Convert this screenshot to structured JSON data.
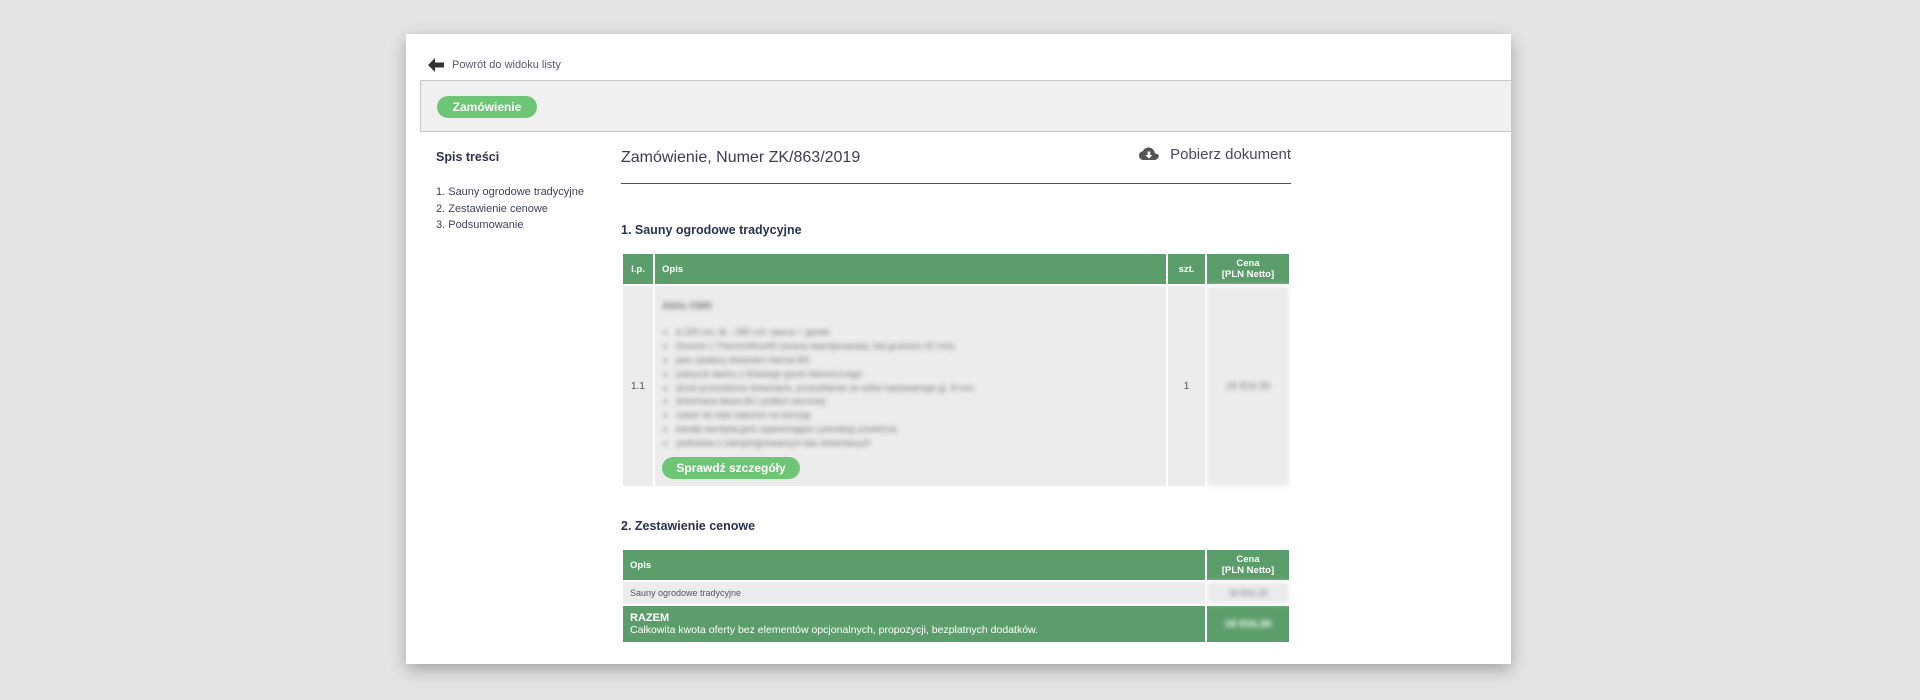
{
  "nav": {
    "back_label": "Powrót do widoku listy"
  },
  "header": {
    "order_button": "Zamówienie"
  },
  "toc": {
    "title": "Spis treści",
    "items": [
      "1. Sauny ogrodowe tradycyjne",
      "2. Zestawienie cenowe",
      "3. Podsumowanie"
    ]
  },
  "document": {
    "title": "Zamówienie, Numer ZK/863/2019",
    "download_label": "Pobierz dokument"
  },
  "section1": {
    "title": "1. Sauny ogrodowe tradycyjne",
    "columns": {
      "lp": "l.p.",
      "desc": "Opis",
      "qty": "szt.",
      "price_line1": "Cena",
      "price_line2": "[PLN Netto]"
    },
    "row": {
      "lp": "1.1",
      "product_name": "Aktiv #360",
      "features": [
        "ø 220 cm, dł. ~280 cm: sauna + ganek",
        "Drewno z ThermoWood® (sosna skandynawska, bal grubości 42 mm)",
        "piec opalany drewnem Harvia M3",
        "pokrycie dachu z fińskiego gontu bitumicznego",
        "drzwi przeszklone drewniane, przeszklenie ze szkła hartowanego gr. 8 mm",
        "drewniane ławeczki i podest saunowy",
        "zawór do stali odporne na korozję",
        "kanały wentylacyjne zapewniające cyrkulację powietrza",
        "podstawa z zaimpregnowanych ław drewnianych"
      ],
      "details_button": "Sprawdź szczegóły",
      "qty": "1",
      "price": "18 816,30"
    }
  },
  "section2": {
    "title": "2. Zestawienie cenowe",
    "columns": {
      "desc": "Opis",
      "price_line1": "Cena",
      "price_line2": "[PLN Netto]"
    },
    "row": {
      "desc": "Sauny ogrodowe tradycyjne",
      "price": "18 816,30"
    },
    "total": {
      "label": "RAZEM",
      "desc": "Całkowita kwota oferty bez elementów opcjonalnych, propozycji, bezpłatnych dodatków.",
      "price": "18 816,30"
    }
  },
  "colors": {
    "accent_green": "#6fc576",
    "table_header_green": "#5c9e6b"
  }
}
